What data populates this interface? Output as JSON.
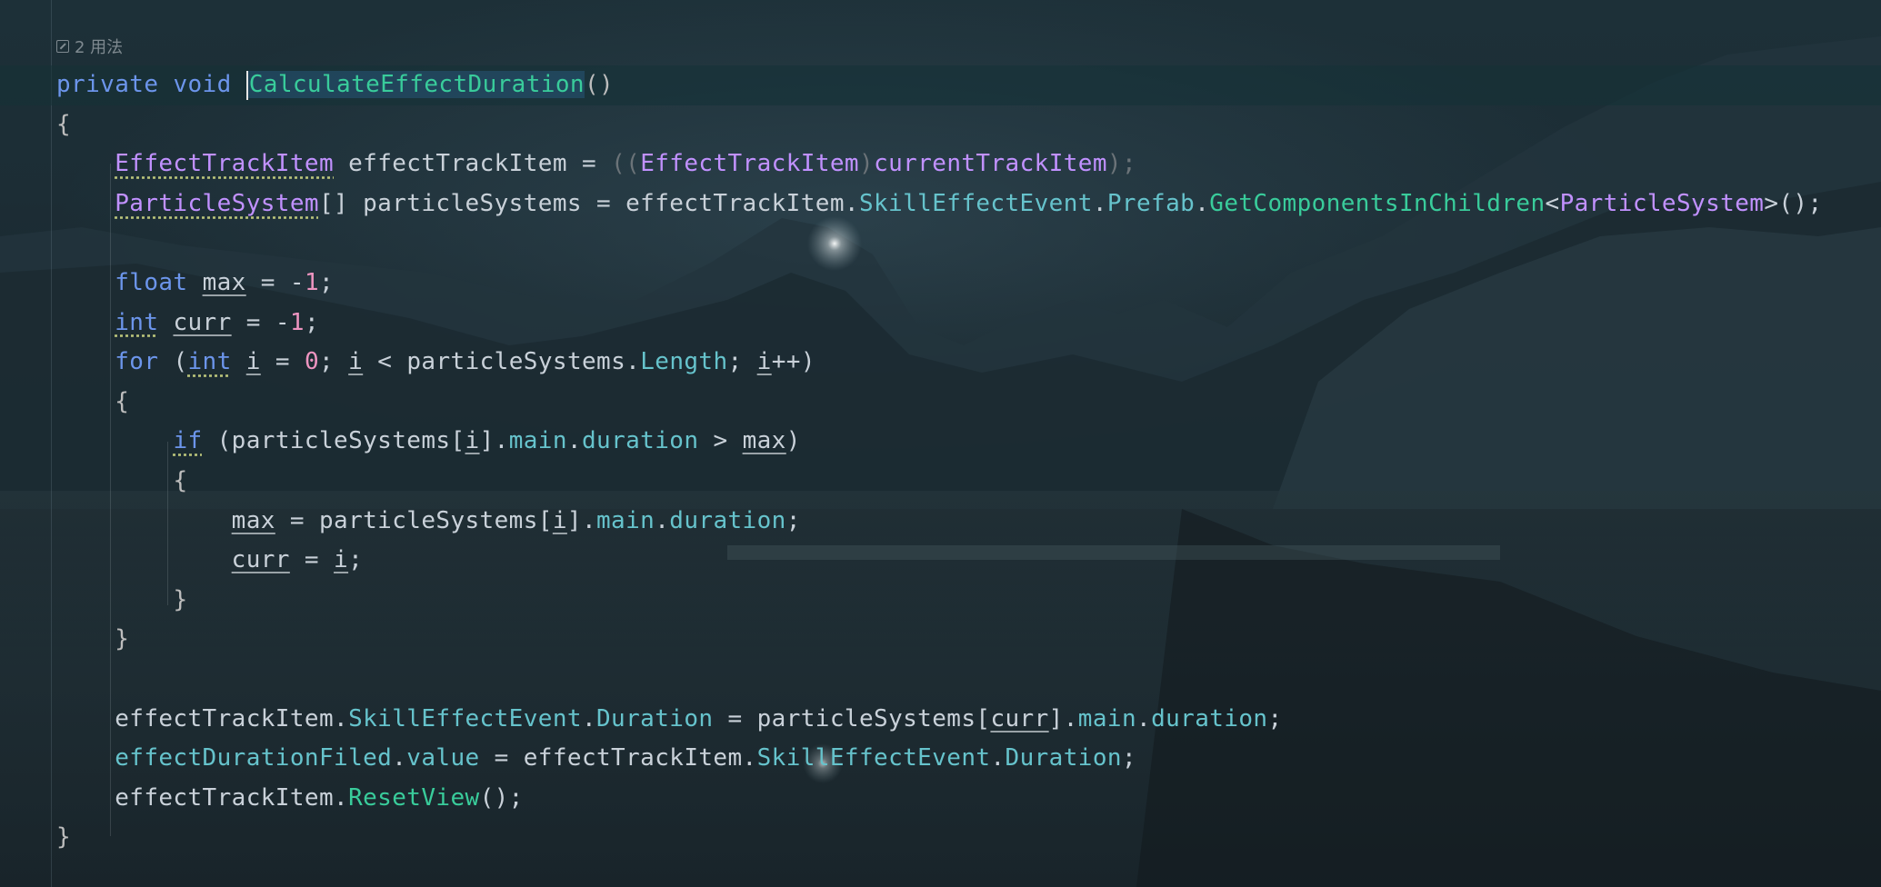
{
  "usage_hint": {
    "count_text": "2 用法"
  },
  "code": {
    "l1": {
      "private": "private",
      "void": "void",
      "name": "CalculateEffectDuration",
      "paren": "()"
    },
    "l2": {
      "brace": "{"
    },
    "l3": {
      "type": "EffectTrackItem",
      "var": "effectTrackItem",
      "eq": " = ",
      "open": "((",
      "cast": "EffectTrackItem",
      "close": ")",
      "src": "currentTrackItem",
      "end": ");"
    },
    "l4": {
      "type": "ParticleSystem",
      "arr": "[]",
      "var": " particleSystems = effectTrackItem.",
      "p1": "SkillEffectEvent",
      "dot1": ".",
      "p2": "Prefab",
      "dot2": ".",
      "fn": "GetComponentsInChildren",
      "lt": "<",
      "gen": "ParticleSystem",
      "end": ">();"
    },
    "l6": {
      "kw": "float",
      "var": "max",
      "eq": " = -",
      "num": "1",
      "end": ";"
    },
    "l7": {
      "kw": "int",
      "var": "curr",
      "eq": " = -",
      "num": "1",
      "end": ";"
    },
    "l8": {
      "kw": "for",
      "open": " (",
      "kw2": "int",
      "sp": " ",
      "i1": "i",
      "eq": " = ",
      "num": "0",
      "semi": "; ",
      "i2": "i",
      "lt": " < particleSystems.",
      "len": "Length",
      "semi2": "; ",
      "i3": "i",
      "end": "++)"
    },
    "l9": {
      "brace": "{"
    },
    "l10": {
      "kw": "if",
      "open": " (particleSystems[",
      "i": "i",
      "close": "].",
      "main": "main",
      "dot": ".",
      "dur": "duration",
      "gt": " > ",
      "max": "max",
      "end": ")"
    },
    "l11": {
      "brace": "{"
    },
    "l12": {
      "max": "max",
      "eq": " = particleSystems[",
      "i": "i",
      "close": "].",
      "main": "main",
      "dot": ".",
      "dur": "duration",
      "end": ";"
    },
    "l13": {
      "curr": "curr",
      "eq": " = ",
      "i": "i",
      "end": ";"
    },
    "l14": {
      "brace": "}"
    },
    "l15": {
      "brace": "}"
    },
    "l17": {
      "a": "effectTrackItem.",
      "p1": "SkillEffectEvent",
      "dot": ".",
      "p2": "Duration",
      "eq": " = particleSystems[",
      "curr": "curr",
      "close": "].",
      "main": "main",
      "dot2": ".",
      "dur": "duration",
      "end": ";"
    },
    "l18": {
      "field": "effectDurationFiled",
      "dot": ".",
      "val": "value",
      "eq": " = effectTrackItem.",
      "p1": "SkillEffectEvent",
      "dot2": ".",
      "p2": "Duration",
      "end": ";"
    },
    "l19": {
      "a": "effectTrackItem.",
      "fn": "ResetView",
      "end": "();"
    },
    "l20": {
      "brace": "}"
    }
  },
  "colors": {
    "keyword": "#6c95eb",
    "type": "#c191ff",
    "property": "#66c3cc",
    "method": "#39cc9b",
    "number": "#ed94c0"
  }
}
